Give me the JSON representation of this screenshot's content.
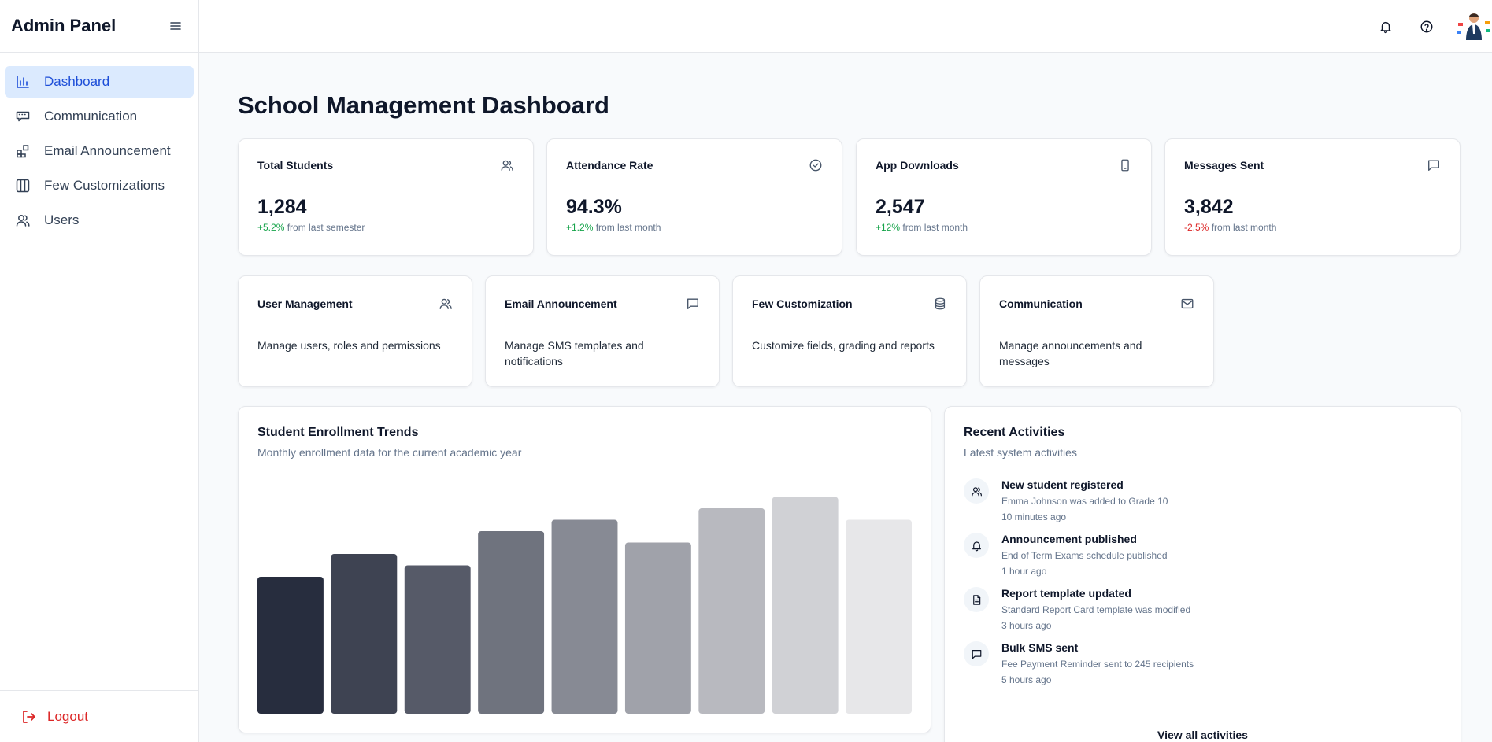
{
  "sidebar": {
    "brand": "Admin Panel",
    "items": [
      {
        "label": "Dashboard",
        "icon": "bar-chart-icon",
        "active": true
      },
      {
        "label": "Communication",
        "icon": "keyboard-icon",
        "active": false
      },
      {
        "label": "Email Announcement",
        "icon": "widgets-icon",
        "active": false
      },
      {
        "label": "Few Customizations",
        "icon": "columns-icon",
        "active": false
      },
      {
        "label": "Users",
        "icon": "users-icon",
        "active": false
      }
    ],
    "logout_label": "Logout"
  },
  "header": {
    "icons": [
      "bell-icon",
      "help-icon",
      "avatar"
    ]
  },
  "main": {
    "title": "School Management Dashboard",
    "stats": [
      {
        "label": "Total Students",
        "value": "1,284",
        "change": "+5.2%",
        "suffix": " from last semester",
        "trend": "pos",
        "icon": "users-icon"
      },
      {
        "label": "Attendance Rate",
        "value": "94.3%",
        "change": "+1.2%",
        "suffix": " from last month",
        "trend": "pos",
        "icon": "check-circle-icon"
      },
      {
        "label": "App Downloads",
        "value": "2,547",
        "change": "+12%",
        "suffix": " from last month",
        "trend": "pos",
        "icon": "smartphone-icon"
      },
      {
        "label": "Messages Sent",
        "value": "3,842",
        "change": "-2.5%",
        "suffix": " from last month",
        "trend": "neg",
        "icon": "message-icon"
      }
    ],
    "modules": [
      {
        "label": "User Management",
        "desc": "Manage users, roles and permissions",
        "icon": "users-icon"
      },
      {
        "label": "Email Announcement",
        "desc": "Manage SMS templates and notifications",
        "icon": "message-icon"
      },
      {
        "label": "Few Customization",
        "desc": "Customize fields, grading and reports",
        "icon": "database-icon"
      },
      {
        "label": "Communication",
        "desc": "Manage announcements and messages",
        "icon": "mail-icon"
      }
    ],
    "chart_section": {
      "title": "Student Enrollment Trends",
      "subtitle": "Monthly enrollment data for the current academic year"
    },
    "activities": {
      "title": "Recent Activities",
      "subtitle": "Latest system activities",
      "items": [
        {
          "title": "New student registered",
          "desc": "Emma Johnson was added to Grade 10",
          "time": "10 minutes ago",
          "icon": "users-icon"
        },
        {
          "title": "Announcement published",
          "desc": "End of Term Exams schedule published",
          "time": "1 hour ago",
          "icon": "bell-icon"
        },
        {
          "title": "Report template updated",
          "desc": "Standard Report Card template was modified",
          "time": "3 hours ago",
          "icon": "file-icon"
        },
        {
          "title": "Bulk SMS sent",
          "desc": "Fee Payment Reminder sent to 245 recipients",
          "time": "5 hours ago",
          "icon": "message-icon"
        }
      ],
      "view_all": "View all activities"
    }
  },
  "chart_data": {
    "type": "bar",
    "title": "Student Enrollment Trends",
    "categories": [
      "",
      "",
      "",
      "",
      "",
      "",
      "",
      "",
      ""
    ],
    "values": [
      60,
      70,
      65,
      80,
      85,
      75,
      90,
      95,
      85
    ],
    "ylim": [
      0,
      100
    ],
    "colors": [
      "#272d3e",
      "#3e4352",
      "#565a68",
      "#6f737e",
      "#878a94",
      "#a0a2aa",
      "#b8b9bf",
      "#d0d1d5",
      "#e7e7e9"
    ],
    "grid": false,
    "legend": "none"
  },
  "colors": {
    "accent": "#1d4ed8",
    "accent_bg": "#dbeafe",
    "positive": "#16a34a",
    "negative": "#dc2626"
  }
}
